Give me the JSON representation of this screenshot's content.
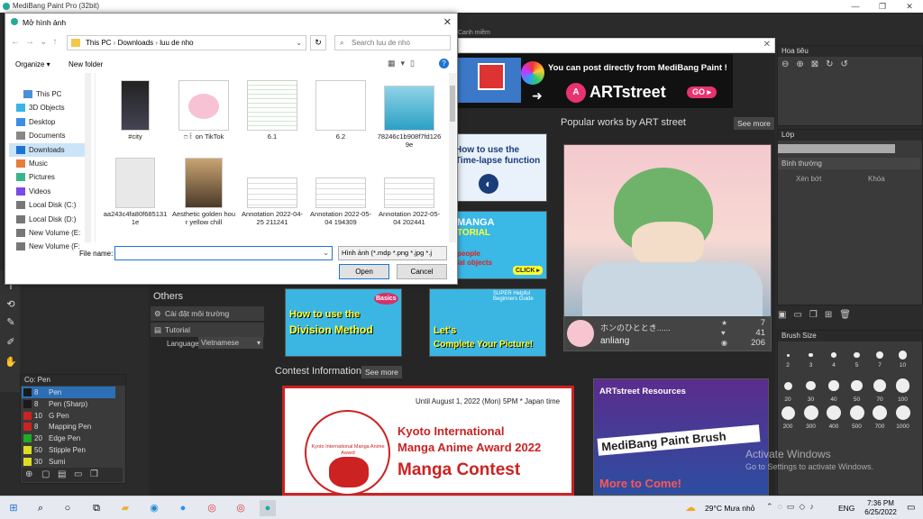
{
  "window": {
    "title": "MediBang Paint Pro (32bit)"
  },
  "dialog": {
    "title": "Mở hình ảnh",
    "path": [
      "This PC",
      "Downloads",
      "luu de nho"
    ],
    "search_placeholder": "Search luu de nho",
    "organize": "Organize ▾",
    "new_folder": "New folder",
    "nav": [
      "This PC",
      "3D Objects",
      "Desktop",
      "Documents",
      "Downloads",
      "Music",
      "Pictures",
      "Videos",
      "Local Disk (C:)",
      "Local Disk (D:)",
      "New Volume (E:",
      "New Volume (F:"
    ],
    "files": [
      {
        "name": "#city"
      },
      {
        "name": "ෆ꒰ on TikTok"
      },
      {
        "name": "6.1"
      },
      {
        "name": "6.2"
      },
      {
        "name": "78246c1b908f7fd1269e"
      },
      {
        "name": "aa243c4fa80f6851311e"
      },
      {
        "name": "Aesthetic golden hour yellow chill"
      },
      {
        "name": "Annotation 2022-04-25 211241"
      },
      {
        "name": "Annotation 2022-05-04 194309"
      },
      {
        "name": "Annotation 2022-05-04 202441"
      }
    ],
    "file_name_label": "File name:",
    "file_name_value": "",
    "file_type": "Hình ảnh (*.mdp *.png *.jpg *.j",
    "open": "Open",
    "cancel": "Cancel"
  },
  "start": {
    "tab_label": "Canh miềm",
    "promo_text": "You can post directly from MediBang Paint !",
    "artstreet": "ARTstreet",
    "go": "GO ▸",
    "popular": "Popular works by ART street",
    "see_more": "See more",
    "work_title": "ホンのひととき......",
    "work_author": "anliang",
    "work_stats": [
      "7",
      "41",
      "206"
    ],
    "tut1": "How to use the Time-lapse function",
    "tut2_a": "MANGA",
    "tut2_b": "TORIAL",
    "tut2_c": "people",
    "tut2_d": "ial objects",
    "tut2_e": "CLICK ▸",
    "div_a": "How to use the",
    "div_b": "Division Method",
    "div_badge": "Basics",
    "complete_a": "Let's",
    "complete_b": "Complete Your Picture!",
    "complete_tag": "SUPER Helpful Beginners Guide",
    "others": "Others",
    "env": "Cài đặt môi trường",
    "tutorial": "Tutorial",
    "language_label": "Language:",
    "language": "Vietnamese",
    "contest": "Contest Information",
    "contest_see": "See more",
    "contest_date": "Until August 1, 2022 (Mon) 5PM * Japan time",
    "contest_t1": "Kyoto International",
    "contest_t2": "Manga Anime Award 2022",
    "contest_t3": "Manga Contest",
    "contest_ring": "Kyoto International Manga Anime Award",
    "res_title": "ARTstreet Resources",
    "res_brush": "MediBang Paint Brush",
    "res_more": "More to Come!"
  },
  "panels": {
    "navigator": "Hoa tiêu",
    "layer": "Lớp",
    "blend": "Bình thường",
    "protect": "Xén bớt",
    "lock": "Khóa",
    "brushsize": "Brush Size",
    "brush_labels": [
      "2",
      "3",
      "4",
      "5",
      "7",
      "10",
      "20",
      "30",
      "40",
      "50",
      "70",
      "100",
      "200",
      "300",
      "400",
      "500",
      "700",
      "1000"
    ],
    "pen_panel": "Cọ: Pen",
    "pens": [
      {
        "size": "8",
        "name": "Pen",
        "color": "#1a1a1a"
      },
      {
        "size": "8",
        "name": "Pen (Sharp)",
        "color": "#1a1a1a"
      },
      {
        "size": "10",
        "name": "G Pen",
        "color": "#cc2222"
      },
      {
        "size": "8",
        "name": "Mapping Pen",
        "color": "#cc2222"
      },
      {
        "size": "20",
        "name": "Edge Pen",
        "color": "#22aa22"
      },
      {
        "size": "50",
        "name": "Stipple Pen",
        "color": "#dddd22"
      },
      {
        "size": "30",
        "name": "Sumi",
        "color": "#dddd22"
      }
    ]
  },
  "watermark": {
    "line1": "Activate Windows",
    "line2": "Go to Settings to activate Windows."
  },
  "taskbar": {
    "weather": "29°C  Mưa nhỏ",
    "lang": "ENG",
    "time": "7:36 PM",
    "date": "6/25/2022"
  }
}
